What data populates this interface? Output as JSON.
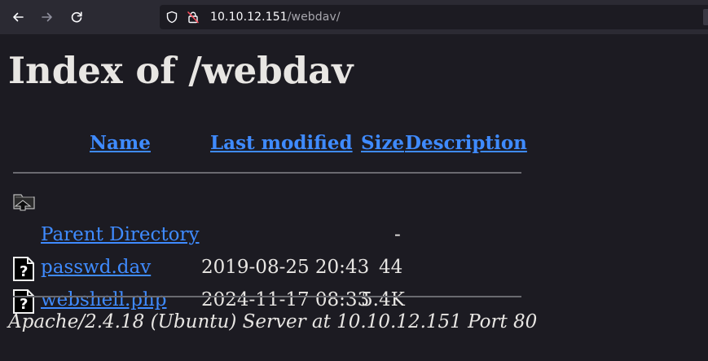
{
  "browser": {
    "url_host": "10.10.12.151",
    "url_path": "/webdav/"
  },
  "page": {
    "title": "Index of /webdav",
    "columns": {
      "name": "Name",
      "last_modified": "Last modified",
      "size": "Size",
      "description": "Description"
    },
    "rows": [
      {
        "icon": "parent-directory-icon",
        "name": "Parent Directory",
        "modified": "",
        "size": "-"
      },
      {
        "icon": "unknown-file-icon",
        "name": "passwd.dav",
        "modified": "2019-08-25 20:43",
        "size": "44"
      },
      {
        "icon": "unknown-file-icon",
        "name": "webshell.php",
        "modified": "2024-11-17 08:33",
        "size": "5.4K"
      }
    ],
    "footer": "Apache/2.4.18 (Ubuntu) Server at 10.10.12.151 Port 80"
  },
  "colors": {
    "background": "#1c1b22",
    "toolbar": "#2b2a33",
    "link": "#3f8bff",
    "text": "#e8e6e3"
  }
}
